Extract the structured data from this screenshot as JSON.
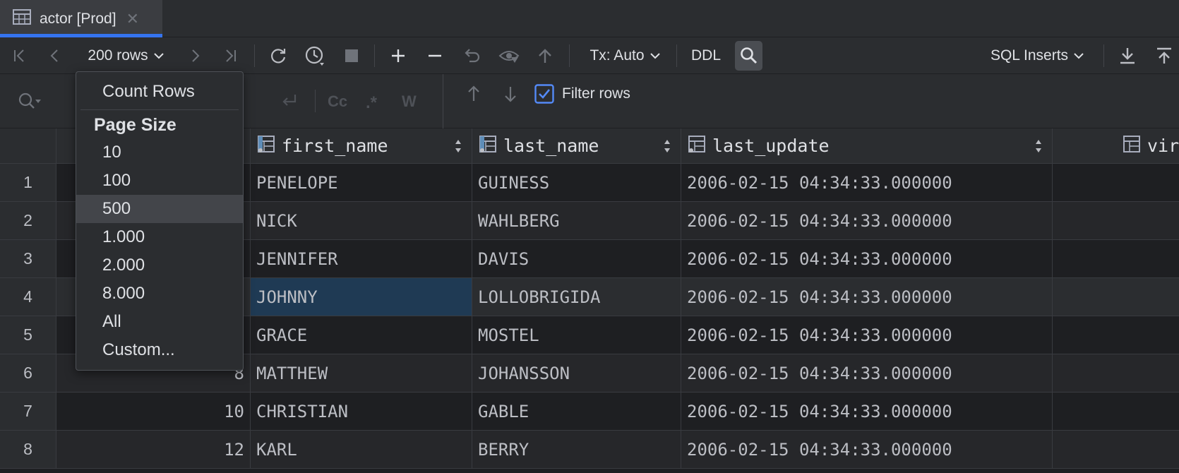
{
  "tab": {
    "title": "actor [Prod]",
    "close_glyph": "✕"
  },
  "toolbar": {
    "page_size_label": "200 rows",
    "tx_label": "Tx: Auto",
    "ddl_label": "DDL",
    "export_format_label": "SQL Inserts"
  },
  "filter": {
    "label": "Filter rows",
    "checked": true
  },
  "page_size_menu": {
    "count_rows": "Count Rows",
    "header": "Page Size",
    "options": [
      "10",
      "100",
      "500",
      "1.000",
      "2.000",
      "8.000",
      "All",
      "Custom..."
    ],
    "highlighted": "500"
  },
  "columns": [
    {
      "name": "first_name"
    },
    {
      "name": "last_name"
    },
    {
      "name": "last_update"
    },
    {
      "name": "vir"
    }
  ],
  "rows": [
    {
      "num": "1",
      "id": "",
      "first_name": "PENELOPE",
      "last_name": "GUINESS",
      "last_update": "2006-02-15 04:34:33.000000"
    },
    {
      "num": "2",
      "id": "",
      "first_name": "NICK",
      "last_name": "WAHLBERG",
      "last_update": "2006-02-15 04:34:33.000000"
    },
    {
      "num": "3",
      "id": "",
      "first_name": "JENNIFER",
      "last_name": "DAVIS",
      "last_update": "2006-02-15 04:34:33.000000"
    },
    {
      "num": "4",
      "id": "",
      "first_name": "JOHNNY",
      "last_name": "LOLLOBRIGIDA",
      "last_update": "2006-02-15 04:34:33.000000"
    },
    {
      "num": "5",
      "id": "",
      "first_name": "GRACE",
      "last_name": "MOSTEL",
      "last_update": "2006-02-15 04:34:33.000000"
    },
    {
      "num": "6",
      "id": "8",
      "first_name": "MATTHEW",
      "last_name": "JOHANSSON",
      "last_update": "2006-02-15 04:34:33.000000"
    },
    {
      "num": "7",
      "id": "10",
      "first_name": "CHRISTIAN",
      "last_name": "GABLE",
      "last_update": "2006-02-15 04:34:33.000000"
    },
    {
      "num": "8",
      "id": "12",
      "first_name": "KARL",
      "last_name": "BERRY",
      "last_update": "2006-02-15 04:34:33.000000"
    }
  ],
  "selected_cell": {
    "row": 3,
    "column": "first_name"
  },
  "colors": {
    "accent": "#3574f0",
    "selection": "#1f3a54",
    "background": "#1e1f22",
    "panel": "#2b2d30"
  }
}
